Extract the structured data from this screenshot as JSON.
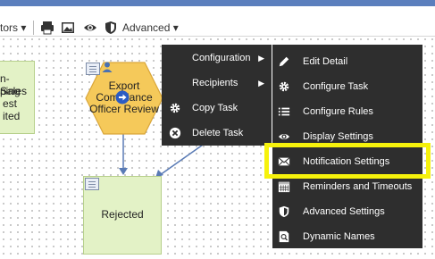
{
  "toolbar": {
    "editors_label": "tors",
    "advanced_label": "Advanced",
    "icons": [
      "printer-icon",
      "image-icon",
      "eye-icon",
      "shield-icon"
    ]
  },
  "nodes": {
    "left_node_lines": [
      "n-Sales",
      "ping",
      "est",
      "ited"
    ],
    "export_task_lines": [
      "Export",
      "Compliance",
      "Officer Review"
    ],
    "rejected_label": "Rejected"
  },
  "context_menu": {
    "items": [
      {
        "label": "Configuration",
        "icon": "blank",
        "has_submenu": true
      },
      {
        "label": "Recipients",
        "icon": "blank",
        "has_submenu": true
      },
      {
        "label": "Copy Task",
        "icon": "gear-icon",
        "has_submenu": false
      },
      {
        "label": "Delete Task",
        "icon": "close-circle-icon",
        "has_submenu": false
      }
    ]
  },
  "configuration_submenu": {
    "items": [
      {
        "label": "Edit Detail",
        "icon": "pencil-icon"
      },
      {
        "label": "Configure Task",
        "icon": "gear-icon"
      },
      {
        "label": "Configure Rules",
        "icon": "list-icon"
      },
      {
        "label": "Display Settings",
        "icon": "eye-icon"
      },
      {
        "label": "Notification Settings",
        "icon": "envelope-icon",
        "highlighted": true
      },
      {
        "label": "Reminders and Timeouts",
        "icon": "calendar-icon"
      },
      {
        "label": "Advanced Settings",
        "icon": "shield-icon"
      },
      {
        "label": "Dynamic Names",
        "icon": "search-doc-icon"
      }
    ]
  },
  "colors": {
    "menu_bg": "#2e2e2e",
    "highlight": "#f6f20c",
    "task_fill": "#f5c95a",
    "node_fill": "#e3f2c6",
    "connector": "#5a7bb5"
  }
}
